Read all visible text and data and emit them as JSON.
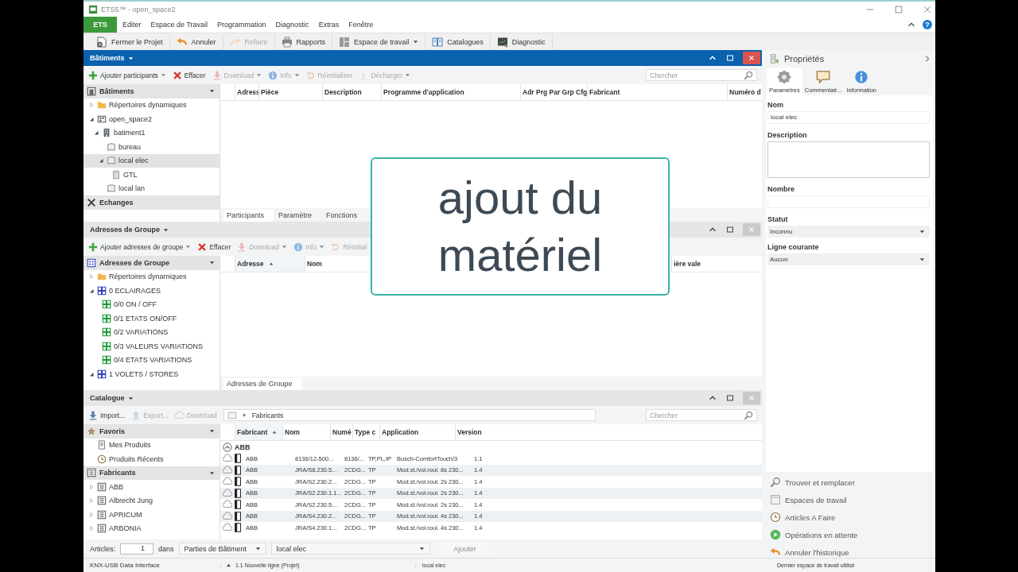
{
  "window": {
    "title": "ETS5™ - open_space2",
    "help": "?"
  },
  "menu": [
    {
      "label": "ETS",
      "selected": true
    },
    {
      "label": "Editer",
      "selected": false
    },
    {
      "label": "Espace de Travail",
      "selected": false
    },
    {
      "label": "Programmation",
      "selected": false
    },
    {
      "label": "Diagnostic",
      "selected": false
    },
    {
      "label": "Extras",
      "selected": false
    },
    {
      "label": "Fenêtre",
      "selected": false
    }
  ],
  "toolbar": [
    {
      "kind": "close-project",
      "label": "Fermer le Projet",
      "disabled": false
    },
    {
      "kind": "undo",
      "label": "Annuler",
      "disabled": false
    },
    {
      "kind": "redo",
      "label": "Refaire",
      "disabled": true
    },
    {
      "kind": "print",
      "label": "Rapports",
      "disabled": false
    },
    {
      "kind": "workspace",
      "label": "Espace de travail",
      "disabled": false,
      "dropdown": true
    },
    {
      "kind": "book",
      "label": "Catalogues",
      "disabled": false
    },
    {
      "kind": "monitor",
      "label": "Diagnostic",
      "disabled": false
    }
  ],
  "panels": [
    {
      "title": "Bâtiments",
      "active": true,
      "actions": [
        {
          "kind": "add",
          "label": "Ajouter participants",
          "disabled": false,
          "dropdown": true
        },
        {
          "kind": "delete",
          "label": "Effacer",
          "disabled": false
        },
        {
          "kind": "download",
          "label": "Download",
          "disabled": true,
          "dropdown": true
        },
        {
          "kind": "info",
          "label": "Info",
          "disabled": true,
          "dropdown": true
        },
        {
          "kind": "reset",
          "label": "Réinitialiser",
          "disabled": true
        },
        {
          "kind": "unload",
          "label": "Décharger",
          "disabled": true,
          "dropdown": true
        }
      ],
      "search": {
        "placeholder": "Chercher"
      },
      "tree": [
        {
          "kind": "buildings",
          "label": "Bâtiments",
          "dropdown": true,
          "children": [
            {
              "kind": "folder",
              "label": "Répertoires dynamiques",
              "expanded": false,
              "selected": false
            },
            {
              "kind": "project",
              "label": "open_space2",
              "expanded": true,
              "selected": false,
              "children": [
                {
                  "kind": "building",
                  "label": "batiment1",
                  "expanded": true,
                  "selected": false,
                  "children": [
                    {
                      "kind": "room",
                      "label": "bureau",
                      "selected": false
                    },
                    {
                      "kind": "room",
                      "label": "local elec",
                      "expanded": true,
                      "selected": true,
                      "children": [
                        {
                          "kind": "cabinet",
                          "label": "GTL",
                          "selected": false
                        }
                      ]
                    },
                    {
                      "kind": "room",
                      "label": "local lan",
                      "selected": false
                    }
                  ]
                }
              ]
            }
          ]
        },
        {
          "kind": "exchanges",
          "label": "Echanges",
          "dropdown": false
        }
      ],
      "columns": [
        {
          "label": "Adress",
          "sorted": false
        },
        {
          "label": "Pièce",
          "sorted": false
        },
        {
          "label": "Description",
          "sorted": false
        },
        {
          "label": "Programme d'application",
          "sorted": false
        },
        {
          "label": "Adr Prg Par Grp Cfg",
          "sorted": false
        },
        {
          "label": "Fabricant",
          "sorted": false
        },
        {
          "label": "Numéro d",
          "sorted": false
        }
      ],
      "tabs": [
        {
          "label": "Participants",
          "selected": true
        },
        {
          "label": "Paramètre",
          "selected": false
        },
        {
          "label": "Fonctions",
          "selected": false
        }
      ]
    },
    {
      "title": "Adresses de Groupe",
      "active": false,
      "actions": [
        {
          "kind": "add",
          "label": "Ajouter adresses de groupe",
          "disabled": false,
          "dropdown": true
        },
        {
          "kind": "delete",
          "label": "Effacer",
          "disabled": false
        },
        {
          "kind": "download",
          "label": "Download",
          "disabled": true,
          "dropdown": true
        },
        {
          "kind": "info",
          "label": "Info",
          "disabled": true,
          "dropdown": true
        },
        {
          "kind": "reset",
          "label": "Réinitial",
          "disabled": true
        }
      ],
      "tree": [
        {
          "kind": "groups",
          "label": "Adresses de Groupe",
          "dropdown": true,
          "children": [
            {
              "kind": "folder",
              "label": "Répertoires dynamiques",
              "expanded": false,
              "selected": false
            },
            {
              "kind": "main-group",
              "label": "0 ECLAIRAGES",
              "expanded": true,
              "selected": false,
              "children": [
                {
                  "kind": "group",
                  "label": "0/0 ON / OFF",
                  "selected": false
                },
                {
                  "kind": "group",
                  "label": "0/1 ETATS ON/OFF",
                  "selected": false
                },
                {
                  "kind": "group",
                  "label": "0/2 VARIATIONS",
                  "selected": false
                },
                {
                  "kind": "group",
                  "label": "0/3 VALEURS VARIATIONS",
                  "selected": false
                },
                {
                  "kind": "group",
                  "label": "0/4 ETATS VARIATIONS",
                  "selected": false
                }
              ]
            },
            {
              "kind": "main-group",
              "label": "1 VOLETS / STORES",
              "expanded": true,
              "selected": false
            }
          ]
        }
      ],
      "columns": [
        {
          "label": "Adresse",
          "sorted": true
        },
        {
          "label": "Nom",
          "sorted": false
        },
        {
          "label": "ière vale",
          "sorted": false
        }
      ],
      "tabs": [
        {
          "label": "Adresses de Groupe",
          "selected": true
        }
      ]
    },
    {
      "title": "Catalogue",
      "active": false,
      "actions": [
        {
          "kind": "import",
          "label": "Import...",
          "disabled": false
        },
        {
          "kind": "export",
          "label": "Export...",
          "disabled": true
        },
        {
          "kind": "cloud",
          "label": "Download",
          "disabled": true
        }
      ],
      "breadcrumb": "Fabricants",
      "search": {
        "placeholder": "Chercher"
      },
      "tree": [
        {
          "kind": "favorites",
          "label": "Favoris",
          "dropdown": true,
          "children": [
            {
              "kind": "products",
              "label": "Mes Produits",
              "selected": false
            },
            {
              "kind": "recent",
              "label": "Produits Récents",
              "selected": false
            }
          ]
        },
        {
          "kind": "makers",
          "label": "Fabricants",
          "dropdown": true,
          "children": [
            {
              "kind": "maker",
              "label": "ABB",
              "expanded": false,
              "selected": false
            },
            {
              "kind": "maker",
              "label": "Albrecht Jung",
              "expanded": false,
              "selected": false
            },
            {
              "kind": "maker",
              "label": "APRICUM",
              "expanded": false,
              "selected": false
            },
            {
              "kind": "maker",
              "label": "ARBONIA",
              "expanded": false,
              "selected": false
            }
          ]
        }
      ],
      "columns": [
        {
          "label": "Fabricant",
          "sorted": true
        },
        {
          "label": "Nom",
          "sorted": false
        },
        {
          "label": "Numé",
          "sorted": false
        },
        {
          "label": "Type c",
          "sorted": false
        },
        {
          "label": "Application",
          "sorted": false
        },
        {
          "label": "Version",
          "sorted": false
        }
      ],
      "group": {
        "label": "ABB",
        "expanded": true
      },
      "rows": [
        [
          "ABB",
          "8136/12-500...",
          "8136/...",
          "TP,PL,IP",
          "Busch-ComfortTouch/3",
          "1.1"
        ],
        [
          "ABB",
          "JRA/S8.230.5...",
          "2CDG...",
          "TP",
          "Mod.st./vol.roul. 8s 230...",
          "1.4"
        ],
        [
          "ABB",
          "JRA/S2.230.2...",
          "2CDG...",
          "TP",
          "Mod.st./vol.roul. 2s 230...",
          "1.4"
        ],
        [
          "ABB",
          "JRA/S2.230.1.1...",
          "2CDG...",
          "TP",
          "Mod.st./vol.roul. 2s 230...",
          "1.4"
        ],
        [
          "ABB",
          "JRA/S2.230.5...",
          "2CDG...",
          "TP",
          "Mod.st./vol.roul. 2s 230...",
          "1.4"
        ],
        [
          "ABB",
          "JRA/S4.230.2...",
          "2CDG...",
          "TP",
          "Mod.st./vol.roul. 4s 230...",
          "1.4"
        ],
        [
          "ABB",
          "JRA/S4.230.1...",
          "2CDG...",
          "TP",
          "Mod.st./vol.roul. 4s 230...",
          "1.4"
        ]
      ]
    }
  ],
  "articles": {
    "label": "Articles:",
    "count": "1",
    "in_label": "dans",
    "scope": "Parties de Bâtiment",
    "target": "local elec",
    "button": {
      "label": "Ajouter",
      "disabled": true
    }
  },
  "properties": {
    "title": "Propriétés",
    "tabs": [
      {
        "kind": "settings",
        "label": "Paramètres",
        "selected": true
      },
      {
        "kind": "comment",
        "label": "Commentair...",
        "selected": false
      },
      {
        "kind": "info",
        "label": "Information",
        "selected": false
      }
    ],
    "fields": [
      {
        "kind": "text",
        "label": "Nom",
        "value": "local elec"
      },
      {
        "kind": "textarea",
        "label": "Description"
      },
      {
        "kind": "text",
        "label": "Nombre"
      },
      {
        "kind": "select",
        "label": "Statut",
        "value": "Inconnu"
      },
      {
        "kind": "select",
        "label": "Ligne courante",
        "value": "Aucun"
      }
    ],
    "links": [
      {
        "kind": "search",
        "label": "Trouver et remplacer"
      },
      {
        "kind": "window",
        "label": "Espaces de travail"
      },
      {
        "kind": "clock",
        "label": "Articles A Faire"
      },
      {
        "kind": "play",
        "label": "Opérations en attente"
      },
      {
        "kind": "undo",
        "label": "Annuler l'historique"
      }
    ]
  },
  "status": {
    "interface": "KNX-USB Data Interface",
    "line": "1.1 Nouvelle ligne (Projet)",
    "location": "local elec",
    "workspace": "Dernier espace de travail utilisé"
  },
  "overlay": {
    "text": "ajout du matériel"
  }
}
